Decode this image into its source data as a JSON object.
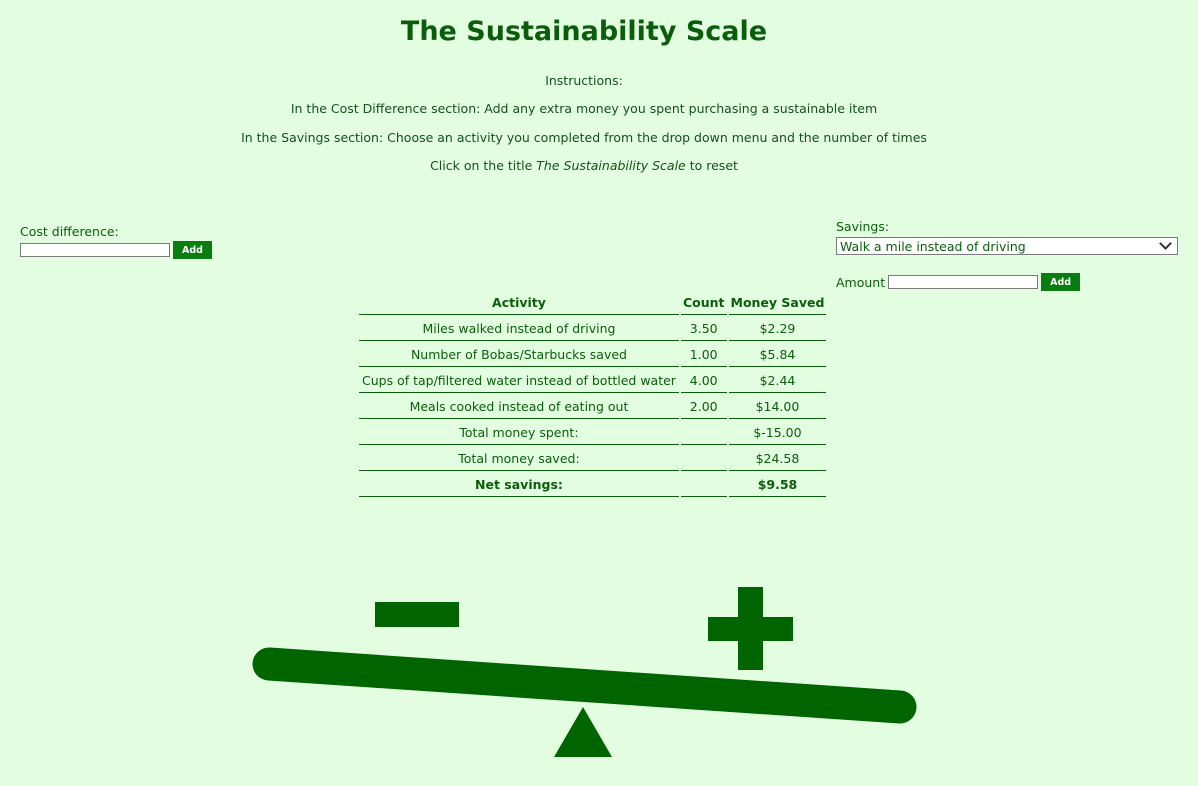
{
  "title": "The Sustainability Scale",
  "instructions": {
    "heading": "Instructions:",
    "line1": "In the Cost Difference section: Add any extra money you spent purchasing a sustainable item",
    "line2": "In the Savings section: Choose an activity you completed from the drop down menu and the number of times",
    "line3_prefix": "Click on the title ",
    "line3_title": "The Sustainability Scale",
    "line3_suffix": " to reset"
  },
  "cost": {
    "label": "Cost difference:",
    "value": "",
    "add_label": "Add"
  },
  "savings": {
    "label": "Savings:",
    "selected": "Walk a mile instead of driving",
    "amount_label": "Amount",
    "amount_value": "",
    "add_label": "Add"
  },
  "table": {
    "headers": [
      "Activity",
      "Count",
      "Money Saved"
    ],
    "rows": [
      [
        "Miles walked instead of driving",
        "3.50",
        "$2.29"
      ],
      [
        "Number of Bobas/Starbucks saved",
        "1.00",
        "$5.84"
      ],
      [
        "Cups of tap/filtered water instead of bottled water",
        "4.00",
        "$2.44"
      ],
      [
        "Meals cooked instead of eating out",
        "2.00",
        "$14.00"
      ]
    ],
    "total_spent": {
      "label": "Total money spent:",
      "value": "$-15.00"
    },
    "total_saved": {
      "label": "Total money saved:",
      "value": "$24.58"
    },
    "net": {
      "label": "Net savings:",
      "value": "$9.58"
    }
  },
  "scale": {
    "minus_icon": "minus-icon",
    "plus_icon": "plus-icon",
    "fulcrum_icon": "triangle-fulcrum-icon",
    "color": "#006400"
  }
}
